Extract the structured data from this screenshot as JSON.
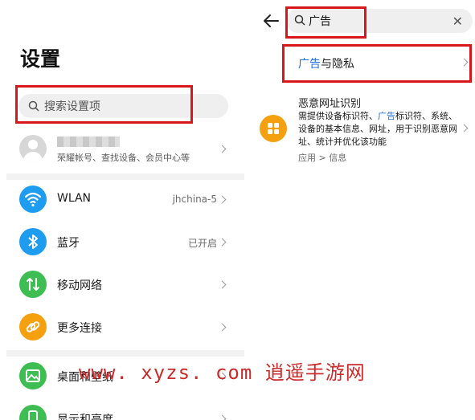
{
  "left": {
    "title": "设置",
    "search_placeholder": "搜索设置项",
    "account_sub": "荣耀帐号、查找设备、会员中心等",
    "items": [
      {
        "label": "WLAN",
        "value": "jhchina-5",
        "icon": "wifi-icon",
        "color": "#1e9cf0"
      },
      {
        "label": "蓝牙",
        "value": "已开启",
        "icon": "bluetooth-icon",
        "color": "#1e9cf0"
      },
      {
        "label": "移动网络",
        "value": "",
        "icon": "mobile-network-icon",
        "color": "#3dbd52"
      },
      {
        "label": "更多连接",
        "value": "",
        "icon": "link-icon",
        "color": "#f5a00f"
      },
      {
        "label": "桌面和壁纸",
        "value": "",
        "icon": "wallpaper-icon",
        "color": "#3dbd52"
      },
      {
        "label": "显示和亮度",
        "value": "",
        "icon": "display-icon",
        "color": "#3dbd52"
      }
    ]
  },
  "right": {
    "search_query": "广告",
    "result1": {
      "highlight": "广告",
      "rest": "与隐私"
    },
    "result2": {
      "title": "恶意网址识别",
      "desc_before": "需提供设备标识符、",
      "desc_highlight": "广告",
      "desc_after": "标识符、系统、设备的基本信息、网址，用于识别恶意网址、统计并优化该功能",
      "path": "应用 > 信息",
      "icon": "apps-grid-icon",
      "color": "#f5a00f"
    }
  },
  "watermark": "www. xyzs. com 逍遥手游网",
  "colors": {
    "accent": "#1f6fd9",
    "annotation": "#d8171a"
  }
}
